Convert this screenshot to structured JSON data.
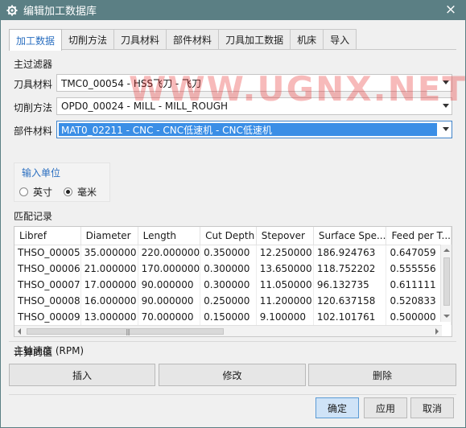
{
  "window": {
    "title": "编辑加工数据库",
    "close_glyph": "×"
  },
  "tabs": [
    {
      "label": "加工数据",
      "active": true
    },
    {
      "label": "切削方法",
      "active": false
    },
    {
      "label": "刀具材料",
      "active": false
    },
    {
      "label": "部件材料",
      "active": false
    },
    {
      "label": "刀具加工数据",
      "active": false
    },
    {
      "label": "机床",
      "active": false
    },
    {
      "label": "导入",
      "active": false
    }
  ],
  "filter": {
    "section_title": "主过滤器",
    "tool_material_label": "刀具材料",
    "tool_material_value": "TMC0_00054 - HSS飞刀 - 飞刀",
    "cut_method_label": "切削方法",
    "cut_method_value": "OPD0_00024 - MILL - MILL_ROUGH",
    "part_material_label": "部件材料",
    "part_material_value": "MAT0_02211 - CNC - CNC低速机 - CNC低速机"
  },
  "units": {
    "title": "输入单位",
    "inch_label": "英寸",
    "mm_label": "毫米",
    "selected": "mm"
  },
  "records": {
    "title": "匹配记录",
    "columns": [
      "Libref",
      "Diameter",
      "Length",
      "Cut Depth",
      "Stepover",
      "Surface Spe...",
      "Feed per T..."
    ],
    "rows": [
      [
        "THSO_00005",
        "35.000000",
        "220.000000",
        "0.350000",
        "12.250000",
        "186.924763",
        "0.647059"
      ],
      [
        "THSO_00006",
        "21.000000",
        "170.000000",
        "0.300000",
        "13.650000",
        "118.752202",
        "0.555556"
      ],
      [
        "THSO_00007",
        "17.000000",
        "90.000000",
        "0.300000",
        "11.050000",
        "96.132735",
        "0.611111"
      ],
      [
        "THSO_00008",
        "16.000000",
        "90.000000",
        "0.250000",
        "11.200000",
        "120.637158",
        "0.520833"
      ],
      [
        "THSO_00009",
        "13.000000",
        "70.000000",
        "0.150000",
        "9.100000",
        "102.101761",
        "0.500000"
      ]
    ]
  },
  "computed": {
    "title": "计算的值",
    "spindle_label": "主轴速度 (RPM)"
  },
  "actions": {
    "insert": "插入",
    "modify": "修改",
    "delete": "删除"
  },
  "dialog": {
    "ok": "确定",
    "apply": "应用",
    "cancel": "取消"
  },
  "watermark": "WWW.UGNX.NET",
  "colors": {
    "titlebar": "#5b7f84",
    "accent": "#2b6fc0",
    "selection": "#3a8ee6"
  }
}
